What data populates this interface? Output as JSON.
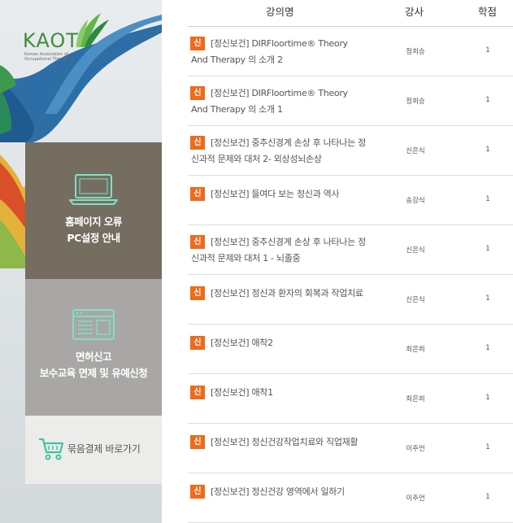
{
  "sidebar": {
    "logo": {
      "mark": "KAOT",
      "subtitle_line1": "Korean Association of",
      "subtitle_line2": "Occupational Therapists"
    },
    "boxes": {
      "error": {
        "line1": "홈페이지 오류",
        "line2": "PC설정 안내",
        "icon": "laptop-icon"
      },
      "license": {
        "line1": "면허신고",
        "line2": "보수교육 면제 및 유예신청",
        "icon": "document-window-icon"
      },
      "cart": {
        "label": "묶음결제 바로가기",
        "icon": "shopping-cart-icon"
      }
    }
  },
  "table": {
    "headers": {
      "title": "강의명",
      "teacher": "강사",
      "credit": "학점"
    },
    "badge": "신",
    "rows": [
      {
        "title": "[정신보건] DIRFloortime® Theory And Therapy 의 소개 2",
        "teacher": "정희승",
        "credit": "1"
      },
      {
        "title": "[정신보건] DIRFloortime® Theory And Therapy 의 소개 1",
        "teacher": "정희승",
        "credit": "1"
      },
      {
        "title": "[정신보건] 중추신경계 손상 후 나타나는 정신과적 문제와 대처 2- 외상성뇌손상",
        "teacher": "신은식",
        "credit": "1"
      },
      {
        "title": "[정신보건] 들여다 보는 정신과 역사",
        "teacher": "송강식",
        "credit": "1"
      },
      {
        "title": "[정신보건] 중추신경계 손상 후 나타나는 정신과적 문제와 대처 1 - 뇌졸중",
        "teacher": "신은식",
        "credit": "1"
      },
      {
        "title": "[정신보건] 정신과 환자의 회복과 작업치료",
        "teacher": "신은식",
        "credit": "1"
      },
      {
        "title": "[정신보건] 애착2",
        "teacher": "최은희",
        "credit": "1"
      },
      {
        "title": "[정신보건] 애착1",
        "teacher": "최은희",
        "credit": "1"
      },
      {
        "title": "[정신보건] 정신건강작업치료와 직업재활",
        "teacher": "이주언",
        "credit": "1"
      },
      {
        "title": "[정신보건] 정신건강 영역에서 일하기",
        "teacher": "이주언",
        "credit": "1"
      }
    ]
  },
  "colors": {
    "badge": "#f06a1a",
    "error_box": "#766d61",
    "license_box": "#a9a7a5",
    "cart_box": "#ececea",
    "icon_mint": "#7fe0c4",
    "logo_green": "#3e8d3a"
  }
}
